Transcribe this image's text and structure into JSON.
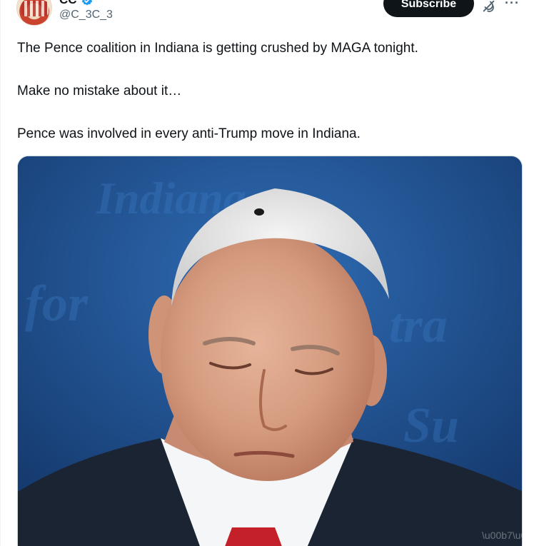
{
  "author": {
    "display_name": "CC",
    "handle": "@C_3C_3"
  },
  "header": {
    "subscribe_label": "Subscribe",
    "more_label": "···"
  },
  "tweet": {
    "lines": [
      "The Pence coalition in Indiana is getting crushed by MAGA tonight.",
      "Make no mistake about it…",
      "Pence was involved in every anti-Trump move in Indiana."
    ]
  },
  "colors": {
    "subscribe_bg": "#0f1419",
    "verified": "#1d9bf0",
    "handle": "#536471",
    "media_bg": "#1f4f8a"
  },
  "icons": [
    "verified-badge-icon",
    "grok-icon",
    "more-icon"
  ]
}
